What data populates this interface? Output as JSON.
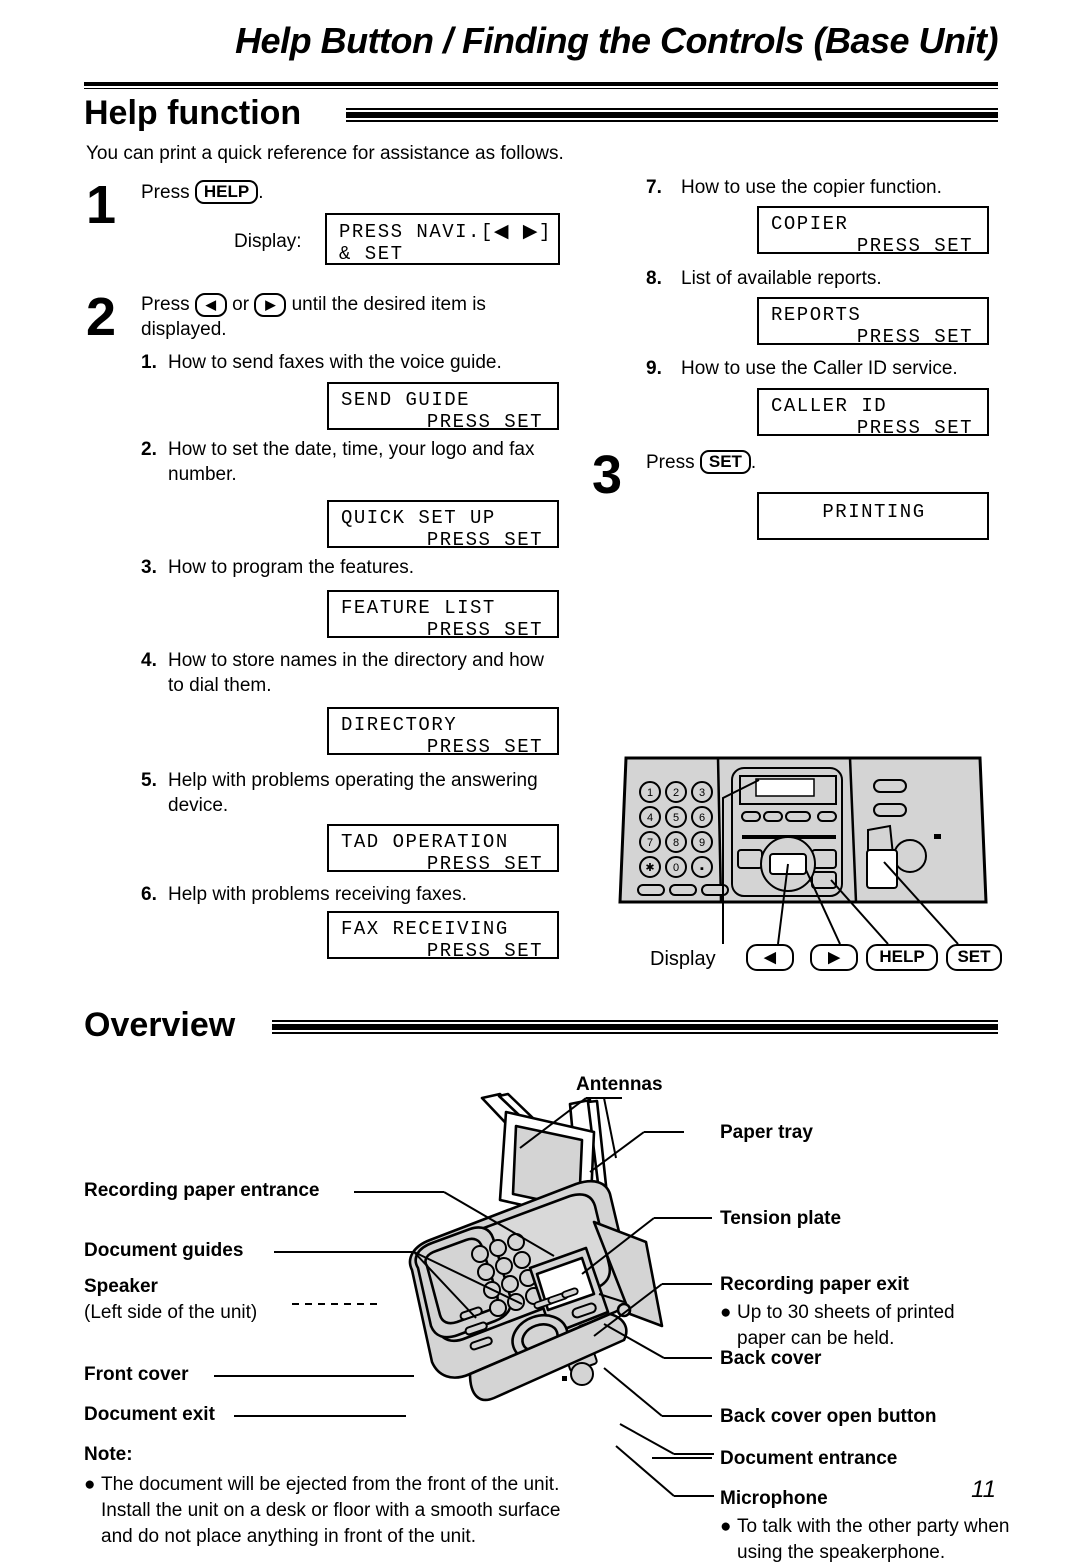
{
  "running_head": "Help Button / Finding the Controls (Base Unit)",
  "page_number": "11",
  "sections": {
    "help": {
      "title": "Help function",
      "intro": "You can print a quick reference for assistance as follows.",
      "step1": {
        "number": "1",
        "press_word": "Press",
        "key": "HELP",
        "period": ".",
        "display_label": "Display:",
        "lcd": {
          "line1": "PRESS NAVI.[◀ ▶]",
          "line2": "& SET"
        }
      },
      "step2": {
        "number": "2",
        "text_before": "Press",
        "key_left": "◀",
        "text_mid": "or",
        "key_right": "▶",
        "text_after": "until the desired item is displayed."
      },
      "step3": {
        "number": "3",
        "press_word": "Press",
        "key": "SET",
        "period": ".",
        "lcd": {
          "line1": "PRINTING"
        }
      },
      "items": [
        {
          "n": "1.",
          "text": "How to send faxes with the voice guide.",
          "lcd1": "SEND GUIDE",
          "lcd2": "PRESS SET"
        },
        {
          "n": "2.",
          "text": "How to set the date, time, your logo and fax number.",
          "lcd1": "QUICK SET UP",
          "lcd2": "PRESS SET"
        },
        {
          "n": "3.",
          "text": "How to program the features.",
          "lcd1": "FEATURE LIST",
          "lcd2": "PRESS SET"
        },
        {
          "n": "4.",
          "text": "How to store names in the directory and how to dial them.",
          "lcd1": "DIRECTORY",
          "lcd2": "PRESS SET"
        },
        {
          "n": "5.",
          "text": "Help with problems operating the answering device.",
          "lcd1": "TAD OPERATION",
          "lcd2": "PRESS SET"
        },
        {
          "n": "6.",
          "text": "Help with problems receiving faxes.",
          "lcd1": "FAX RECEIVING",
          "lcd2": "PRESS SET"
        },
        {
          "n": "7.",
          "text": "How to use the copier function.",
          "lcd1": "COPIER",
          "lcd2": "PRESS SET"
        },
        {
          "n": "8.",
          "text": "List of available reports.",
          "lcd1": "REPORTS",
          "lcd2": "PRESS SET"
        },
        {
          "n": "9.",
          "text": "How to use the Caller ID service.",
          "lcd1": "CALLER ID",
          "lcd2": "PRESS SET"
        }
      ],
      "control_panel": {
        "display_caption": "Display",
        "key_left": "◀",
        "key_right": "▶",
        "key_help": "HELP",
        "key_set": "SET",
        "keypad": [
          "1",
          "2",
          "3",
          "4",
          "5",
          "6",
          "7",
          "8",
          "9",
          "✱",
          "0",
          "▣"
        ]
      }
    },
    "overview": {
      "title": "Overview",
      "labels_left": [
        "Recording paper entrance",
        "Document guides",
        "Speaker",
        "Front cover",
        "Document exit"
      ],
      "speaker_sub": "(Left side of the unit)",
      "labels_right": [
        "Antennas",
        "Paper tray",
        "Tension plate",
        "Recording paper exit",
        "Back cover",
        "Back cover open button",
        "Document entrance",
        "Microphone"
      ],
      "paper_exit_note": "Up to 30 sheets of printed paper can be held.",
      "microphone_note": "To talk with the other party when using the speakerphone.",
      "note_title": "Note:",
      "note_body": "The document will be ejected from the front of the unit. Install the unit on a desk or floor with a smooth surface and do not place anything in front of the unit."
    }
  }
}
